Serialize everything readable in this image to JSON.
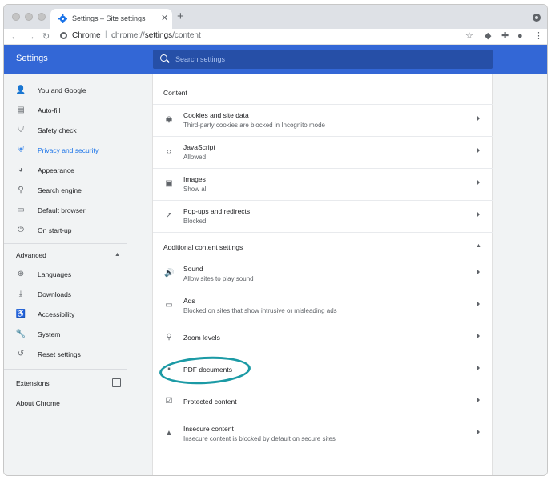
{
  "browser": {
    "tab_title": "Settings – Site settings",
    "tab_close": "✕",
    "new_tab": "+",
    "url_origin": "Chrome",
    "url_separator": "|",
    "url_prefix": "chrome://",
    "url_bold": "settings",
    "url_suffix": "/content",
    "nav": {
      "back": "←",
      "forward": "→",
      "reload": "↻"
    },
    "toolbar_icons": {
      "star": "☆",
      "tag": "◆",
      "puzzle": "✚",
      "avatar": "●",
      "menu": "⋮"
    }
  },
  "header": {
    "title": "Settings",
    "search_placeholder": "Search settings"
  },
  "sidebar": {
    "items": [
      {
        "label": "You and Google",
        "icon": "👤",
        "icon_name": "person-icon"
      },
      {
        "label": "Auto-fill",
        "icon": "▤",
        "icon_name": "clipboard-icon"
      },
      {
        "label": "Safety check",
        "icon": "⛉",
        "icon_name": "shield-check-icon"
      },
      {
        "label": "Privacy and security",
        "icon": "⛨",
        "icon_name": "shield-icon",
        "active": true
      },
      {
        "label": "Appearance",
        "icon": "◕",
        "icon_name": "palette-icon"
      },
      {
        "label": "Search engine",
        "icon": "⚲",
        "icon_name": "search-icon"
      },
      {
        "label": "Default browser",
        "icon": "▭",
        "icon_name": "browser-icon"
      },
      {
        "label": "On start-up",
        "icon": "⏻",
        "icon_name": "power-icon"
      }
    ],
    "advanced_label": "Advanced",
    "advanced_chevron": "▲",
    "advanced_items": [
      {
        "label": "Languages",
        "icon": "⊕",
        "icon_name": "globe-icon"
      },
      {
        "label": "Downloads",
        "icon": "⤓",
        "icon_name": "download-icon"
      },
      {
        "label": "Accessibility",
        "icon": "♿",
        "icon_name": "accessibility-icon"
      },
      {
        "label": "System",
        "icon": "🔧",
        "icon_name": "wrench-icon"
      },
      {
        "label": "Reset settings",
        "icon": "↺",
        "icon_name": "reset-icon"
      }
    ],
    "extensions_label": "Extensions",
    "about_label": "About Chrome"
  },
  "content": {
    "section_title": "Content",
    "rows": [
      {
        "title": "Cookies and site data",
        "sub": "Third-party cookies are blocked in Incognito mode",
        "icon": "◉",
        "icon_name": "cookie-icon"
      },
      {
        "title": "JavaScript",
        "sub": "Allowed",
        "icon": "‹›",
        "icon_name": "code-icon"
      },
      {
        "title": "Images",
        "sub": "Show all",
        "icon": "▣",
        "icon_name": "image-icon"
      },
      {
        "title": "Pop-ups and redirects",
        "sub": "Blocked",
        "icon": "↗",
        "icon_name": "popup-icon"
      }
    ],
    "additional_title": "Additional content settings",
    "additional_chevron": "▲",
    "additional_rows": [
      {
        "title": "Sound",
        "sub": "Allow sites to play sound",
        "icon": "🔊",
        "icon_name": "speaker-icon"
      },
      {
        "title": "Ads",
        "sub": "Blocked on sites that show intrusive or misleading ads",
        "icon": "▭",
        "icon_name": "ads-icon"
      },
      {
        "title": "Zoom levels",
        "sub": "",
        "icon": "⚲",
        "icon_name": "zoom-icon"
      },
      {
        "title": "PDF documents",
        "sub": "",
        "icon": "▪",
        "icon_name": "pdf-icon"
      },
      {
        "title": "Protected content",
        "sub": "",
        "icon": "☑",
        "icon_name": "protected-content-icon"
      },
      {
        "title": "Insecure content",
        "sub": "Insecure content is blocked by default on secure sites",
        "icon": "▲",
        "icon_name": "warning-icon"
      }
    ]
  },
  "colors": {
    "header_blue": "#3367d6",
    "search_blue": "#264fa7",
    "active_blue": "#1a73e8",
    "annotation_teal": "#1b9aa5"
  }
}
